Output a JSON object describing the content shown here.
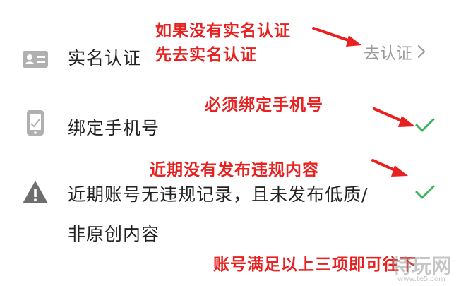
{
  "rows": [
    {
      "label": "实名认证",
      "action_label": "去认证",
      "icon": "id-card-icon"
    },
    {
      "label": "绑定手机号",
      "icon": "phone-icon",
      "status": "check-icon"
    },
    {
      "label_line1": "近期账号无违规记录，且未发布低质/",
      "label_line2": "非原创内容",
      "icon": "warning-icon",
      "status": "check-icon"
    }
  ],
  "notes": {
    "note1_line1": "如果没有实名认证",
    "note1_line2": "先去实名认证",
    "note2": "必须绑定手机号",
    "note3": "近期没有发布违规内容",
    "note4": "账号满足以上三项即可",
    "note4_tail": "往下"
  },
  "watermark": {
    "text": "特玩网",
    "url": "www.te5.com"
  },
  "colors": {
    "annotation": "#e8201f",
    "check": "#3ab55a",
    "icon": "#b0b0b0",
    "text": "#222222",
    "muted": "#9a9a9a"
  }
}
